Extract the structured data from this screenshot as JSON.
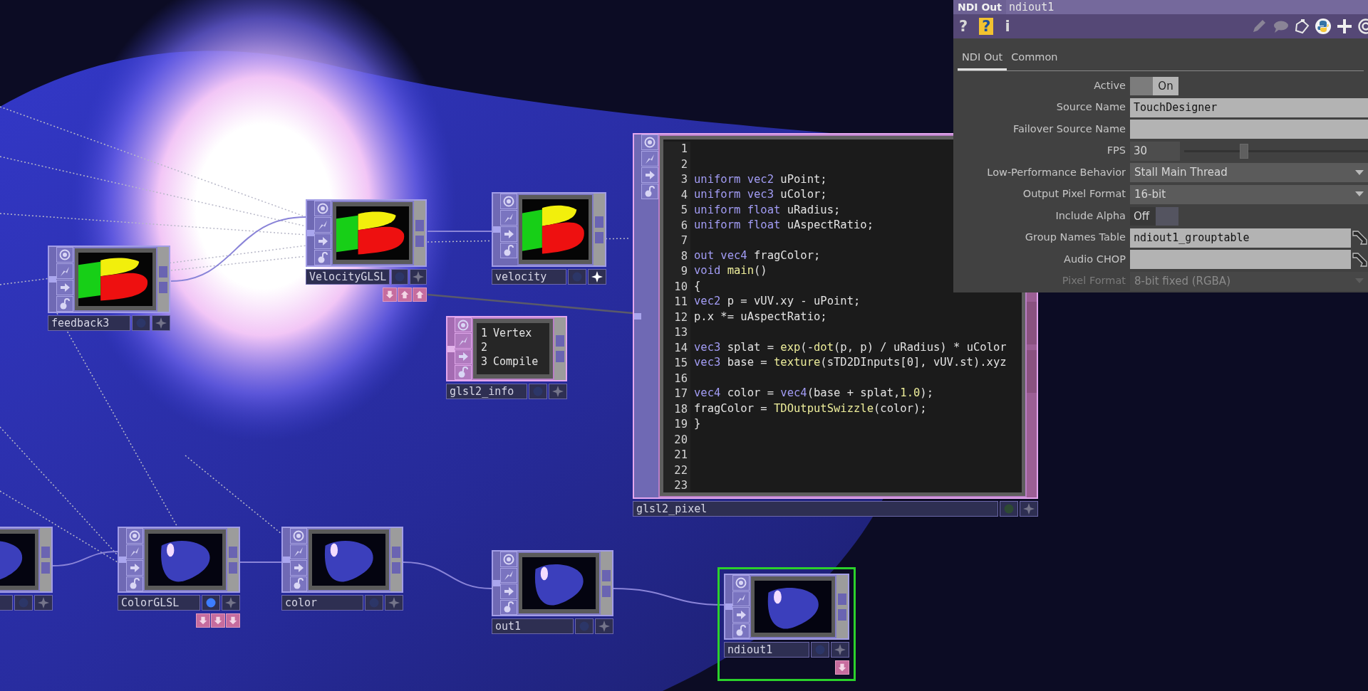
{
  "network": {
    "nodes": [
      {
        "name": "feedback3",
        "kind": "tricolor",
        "selected": false,
        "display_flag": false,
        "render_flag": false
      },
      {
        "name": "VelocityGLSL",
        "kind": "tricolor",
        "selected": false,
        "display_flag": false,
        "render_flag": false,
        "docked": [
          {
            "kind": "down"
          },
          {
            "kind": "up"
          },
          {
            "kind": "up"
          }
        ]
      },
      {
        "name": "velocity",
        "kind": "tricolor",
        "selected": false,
        "display_flag": false,
        "render_flag": true
      },
      {
        "name": "glsl2_info",
        "kind": "text",
        "selected": false,
        "display_flag": false,
        "render_flag": false,
        "lines": [
          {
            "number": "1",
            "text": "Vertex"
          },
          {
            "number": "2"
          },
          {
            "number": "3",
            "text": "Compile"
          }
        ]
      },
      {
        "kind": "blob",
        "selected": false,
        "display_flag": false,
        "render_flag": false
      },
      {
        "name": "ColorGLSL",
        "kind": "blob",
        "selected": false,
        "display_flag": true,
        "render_flag": false,
        "docked": [
          {
            "kind": "down"
          },
          {
            "kind": "down"
          },
          {
            "kind": "down"
          }
        ]
      },
      {
        "name": "color",
        "kind": "blob",
        "selected": false,
        "display_flag": false,
        "render_flag": false
      },
      {
        "name": "out1",
        "kind": "blob",
        "selected": false,
        "display_flag": false,
        "render_flag": false
      },
      {
        "name": "ndiout1",
        "kind": "blob",
        "selected": true,
        "display_flag": false,
        "render_flag": false,
        "docked": [
          {
            "kind": "down"
          }
        ]
      }
    ],
    "code_node": {
      "name": "glsl2_pixel",
      "lines": [
        {
          "number": "1"
        },
        {
          "number": "2"
        },
        {
          "number": "3",
          "tokens": [
            {
              "text": "uniform vec2",
              "kind": "keyword"
            },
            {
              "text": " uPoint;",
              "kind": "plain"
            }
          ]
        },
        {
          "number": "4",
          "tokens": [
            {
              "text": "uniform vec3",
              "kind": "keyword"
            },
            {
              "text": " uColor;",
              "kind": "plain"
            }
          ]
        },
        {
          "number": "5",
          "tokens": [
            {
              "text": "uniform float",
              "kind": "keyword"
            },
            {
              "text": " uRadius;",
              "kind": "plain"
            }
          ]
        },
        {
          "number": "6",
          "tokens": [
            {
              "text": "uniform float",
              "kind": "keyword"
            },
            {
              "text": " uAspectRatio;",
              "kind": "plain"
            }
          ]
        },
        {
          "number": "7"
        },
        {
          "number": "8",
          "tokens": [
            {
              "text": "out vec4",
              "kind": "keyword"
            },
            {
              "text": " fragColor;",
              "kind": "plain"
            }
          ]
        },
        {
          "number": "9",
          "tokens": [
            {
              "text": "void",
              "kind": "keyword"
            },
            {
              "text": " main",
              "kind": "function"
            },
            {
              "text": "()",
              "kind": "plain"
            }
          ]
        },
        {
          "number": "10",
          "tokens": [
            {
              "text": "{",
              "kind": "plain"
            }
          ]
        },
        {
          "number": "11",
          "tokens": [
            {
              "text": "vec2",
              "kind": "keyword"
            },
            {
              "text": " p = vUV.xy - uPoint;",
              "kind": "plain"
            }
          ]
        },
        {
          "number": "12",
          "tokens": [
            {
              "text": "p.x *= uAspectRatio;",
              "kind": "plain"
            }
          ]
        },
        {
          "number": "13"
        },
        {
          "number": "14",
          "tokens": [
            {
              "text": "vec3",
              "kind": "keyword"
            },
            {
              "text": " splat = ",
              "kind": "plain"
            },
            {
              "text": "exp",
              "kind": "function"
            },
            {
              "text": "(-",
              "kind": "plain"
            },
            {
              "text": "dot",
              "kind": "function"
            },
            {
              "text": "(p, p) / uRadius) * uColor",
              "kind": "plain"
            }
          ]
        },
        {
          "number": "15",
          "tokens": [
            {
              "text": "vec3",
              "kind": "keyword"
            },
            {
              "text": " base = ",
              "kind": "plain"
            },
            {
              "text": "texture",
              "kind": "function"
            },
            {
              "text": "(sTD2DInputs[0], vUV.st).xyz",
              "kind": "plain"
            }
          ]
        },
        {
          "number": "16"
        },
        {
          "number": "17",
          "tokens": [
            {
              "text": "vec4",
              "kind": "keyword"
            },
            {
              "text": " color = ",
              "kind": "plain"
            },
            {
              "text": "vec4",
              "kind": "keyword"
            },
            {
              "text": "(base + splat,",
              "kind": "plain"
            },
            {
              "text": "1.0",
              "kind": "function"
            },
            {
              "text": ");",
              "kind": "plain"
            }
          ]
        },
        {
          "number": "18",
          "tokens": [
            {
              "text": "fragColor = ",
              "kind": "plain"
            },
            {
              "text": "TDOutputSwizzle",
              "kind": "function"
            },
            {
              "text": "(color);",
              "kind": "plain"
            }
          ]
        },
        {
          "number": "19",
          "tokens": [
            {
              "text": "}",
              "kind": "plain"
            }
          ]
        },
        {
          "number": "20"
        },
        {
          "number": "21"
        },
        {
          "number": "22"
        },
        {
          "number": "23"
        }
      ]
    }
  },
  "parameters": {
    "header": {
      "type": "NDI Out",
      "name": "ndiout1"
    },
    "toolbar": {
      "left": [
        {
          "glyph": "?",
          "kind": "help"
        },
        {
          "glyph": "?",
          "kind": "python-help"
        },
        {
          "glyph": "i",
          "kind": "info"
        }
      ]
    },
    "tabs": [
      {
        "label": "NDI Out",
        "selected": true
      },
      {
        "label": "Common",
        "selected": false
      }
    ],
    "rows": [
      {
        "label": "Active",
        "kind": "toggle",
        "on": true,
        "value": "On",
        "disabled": false
      },
      {
        "label": "Source Name",
        "kind": "text",
        "value": "TouchDesigner",
        "disabled": false
      },
      {
        "label": "Failover Source Name",
        "kind": "text",
        "disabled": false
      },
      {
        "label": "FPS",
        "kind": "slider",
        "value": "30",
        "level": 0.32,
        "disabled": false
      },
      {
        "label": "Low-Performance Behavior",
        "kind": "menu",
        "value": "Stall Main Thread",
        "disabled": false
      },
      {
        "label": "Output Pixel Format",
        "kind": "menu",
        "value": "16-bit",
        "disabled": false
      },
      {
        "label": "Include Alpha",
        "kind": "toggle",
        "on": false,
        "value": "Off",
        "disabled": false
      },
      {
        "label": "Group Names Table",
        "kind": "reference",
        "value": "ndiout1_grouptable",
        "disabled": false
      },
      {
        "label": "Audio CHOP",
        "kind": "reference",
        "disabled": false
      },
      {
        "label": "Pixel Format",
        "kind": "menu",
        "value": "8-bit fixed (RGBA)",
        "disabled": true
      }
    ]
  }
}
